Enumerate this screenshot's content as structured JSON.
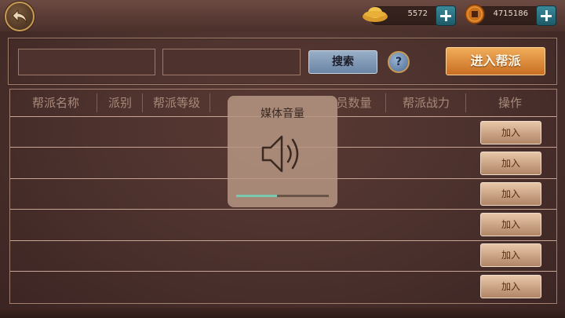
{
  "header": {
    "gold": "5572",
    "coins": "4715186"
  },
  "search": {
    "field1_value": "",
    "field2_value": "",
    "search_label": "搜索",
    "help_label": "?",
    "enter_label": "进入帮派"
  },
  "table": {
    "headers": [
      "帮派名称",
      "派别",
      "帮派等级",
      "",
      "员数量",
      "帮派战力",
      "操作"
    ],
    "join_label": "加入",
    "rows": 6
  },
  "volume": {
    "title": "媒体音量",
    "level": 0.44
  },
  "colors": {
    "accent_orange": "#e08a35",
    "plus_teal": "#2d7a8a",
    "volume_fill": "#7ac8b0"
  }
}
